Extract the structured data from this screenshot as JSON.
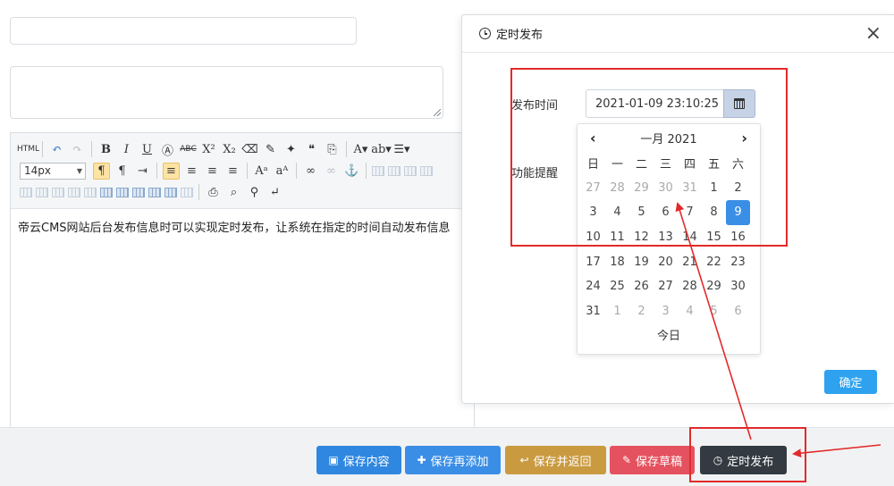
{
  "editor": {
    "content": "帝云CMS网站后台发布信息时可以实现定时发布，让系统在指定的时间自动发布信息",
    "font_size": "14px",
    "html_label": "HTML"
  },
  "footer": {
    "buttons": [
      {
        "label": "保存内容",
        "icon": "save-icon",
        "color": "#2f87e0"
      },
      {
        "label": "保存再添加",
        "icon": "plus-icon",
        "color": "#3a8ee6"
      },
      {
        "label": "保存并返回",
        "icon": "reply-icon",
        "color": "#c99a3f"
      },
      {
        "label": "保存草稿",
        "icon": "pencil-icon",
        "color": "#e5525f"
      },
      {
        "label": "定时发布",
        "icon": "clock-icon",
        "color": "#333a41"
      }
    ]
  },
  "modal": {
    "title": "定时发布",
    "close_glyph": "×",
    "publish_time_label": "发布时间",
    "remind_label": "功能提醒",
    "publish_time_value": "2021-01-09 23:10:25",
    "ok_label": "确定"
  },
  "datepicker": {
    "prev": "‹",
    "next": "›",
    "month_label": "一月 2021",
    "weekdays": [
      "日",
      "一",
      "二",
      "三",
      "四",
      "五",
      "六"
    ],
    "weeks": [
      [
        "27",
        "28",
        "29",
        "30",
        "31",
        "1",
        "2"
      ],
      [
        "3",
        "4",
        "5",
        "6",
        "7",
        "8",
        "9"
      ],
      [
        "10",
        "11",
        "12",
        "13",
        "14",
        "15",
        "16"
      ],
      [
        "17",
        "18",
        "19",
        "20",
        "21",
        "22",
        "23"
      ],
      [
        "24",
        "25",
        "26",
        "27",
        "28",
        "29",
        "30"
      ],
      [
        "31",
        "1",
        "2",
        "3",
        "4",
        "5",
        "6"
      ]
    ],
    "selected_day": "9",
    "today_label": "今日"
  },
  "colors": {
    "annotation": "#e22a2a",
    "selected": "#3a8ee6"
  }
}
